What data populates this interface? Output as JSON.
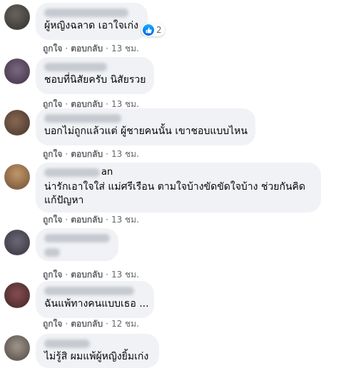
{
  "actions": {
    "like": "ถูกใจ",
    "reply": "ตอบกลับ",
    "separator": "·"
  },
  "comments": [
    {
      "text": "ผู้หญิงฉลาด เอาใจเก่ง",
      "time": "13 ชม.",
      "reactions": {
        "icon": "like-icon",
        "count": "2"
      }
    },
    {
      "text": "ชอบที่นิสัยครับ นิสัยรวย",
      "time": "13 ชม."
    },
    {
      "text": "บอกไม่ถูกแล้วแต่ ผู้ชายคนนั้น เขาชอบแบบไหน",
      "time": "13 ชม."
    },
    {
      "name_suffix": "an",
      "text": "น่ารักเอาใจใส่ แม่ศรีเรือน ตามใจบ้างขัดขัดใจบ้าง ช่วยกันคิดแก้ปัญหา",
      "time": "13 ชม."
    },
    {
      "text": "",
      "time": "13 ชม."
    },
    {
      "text": "ฉันแพ้ทางคนแบบเธอ ...",
      "time": "12 ชม."
    },
    {
      "text": "ไม่รู้สิ ผมแพ้ผู้หญิงยิ้มเก่ง"
    }
  ],
  "colors": {
    "bubble": "#f0f2f5",
    "meta": "#65676b",
    "like_blue": "#1877f2"
  }
}
